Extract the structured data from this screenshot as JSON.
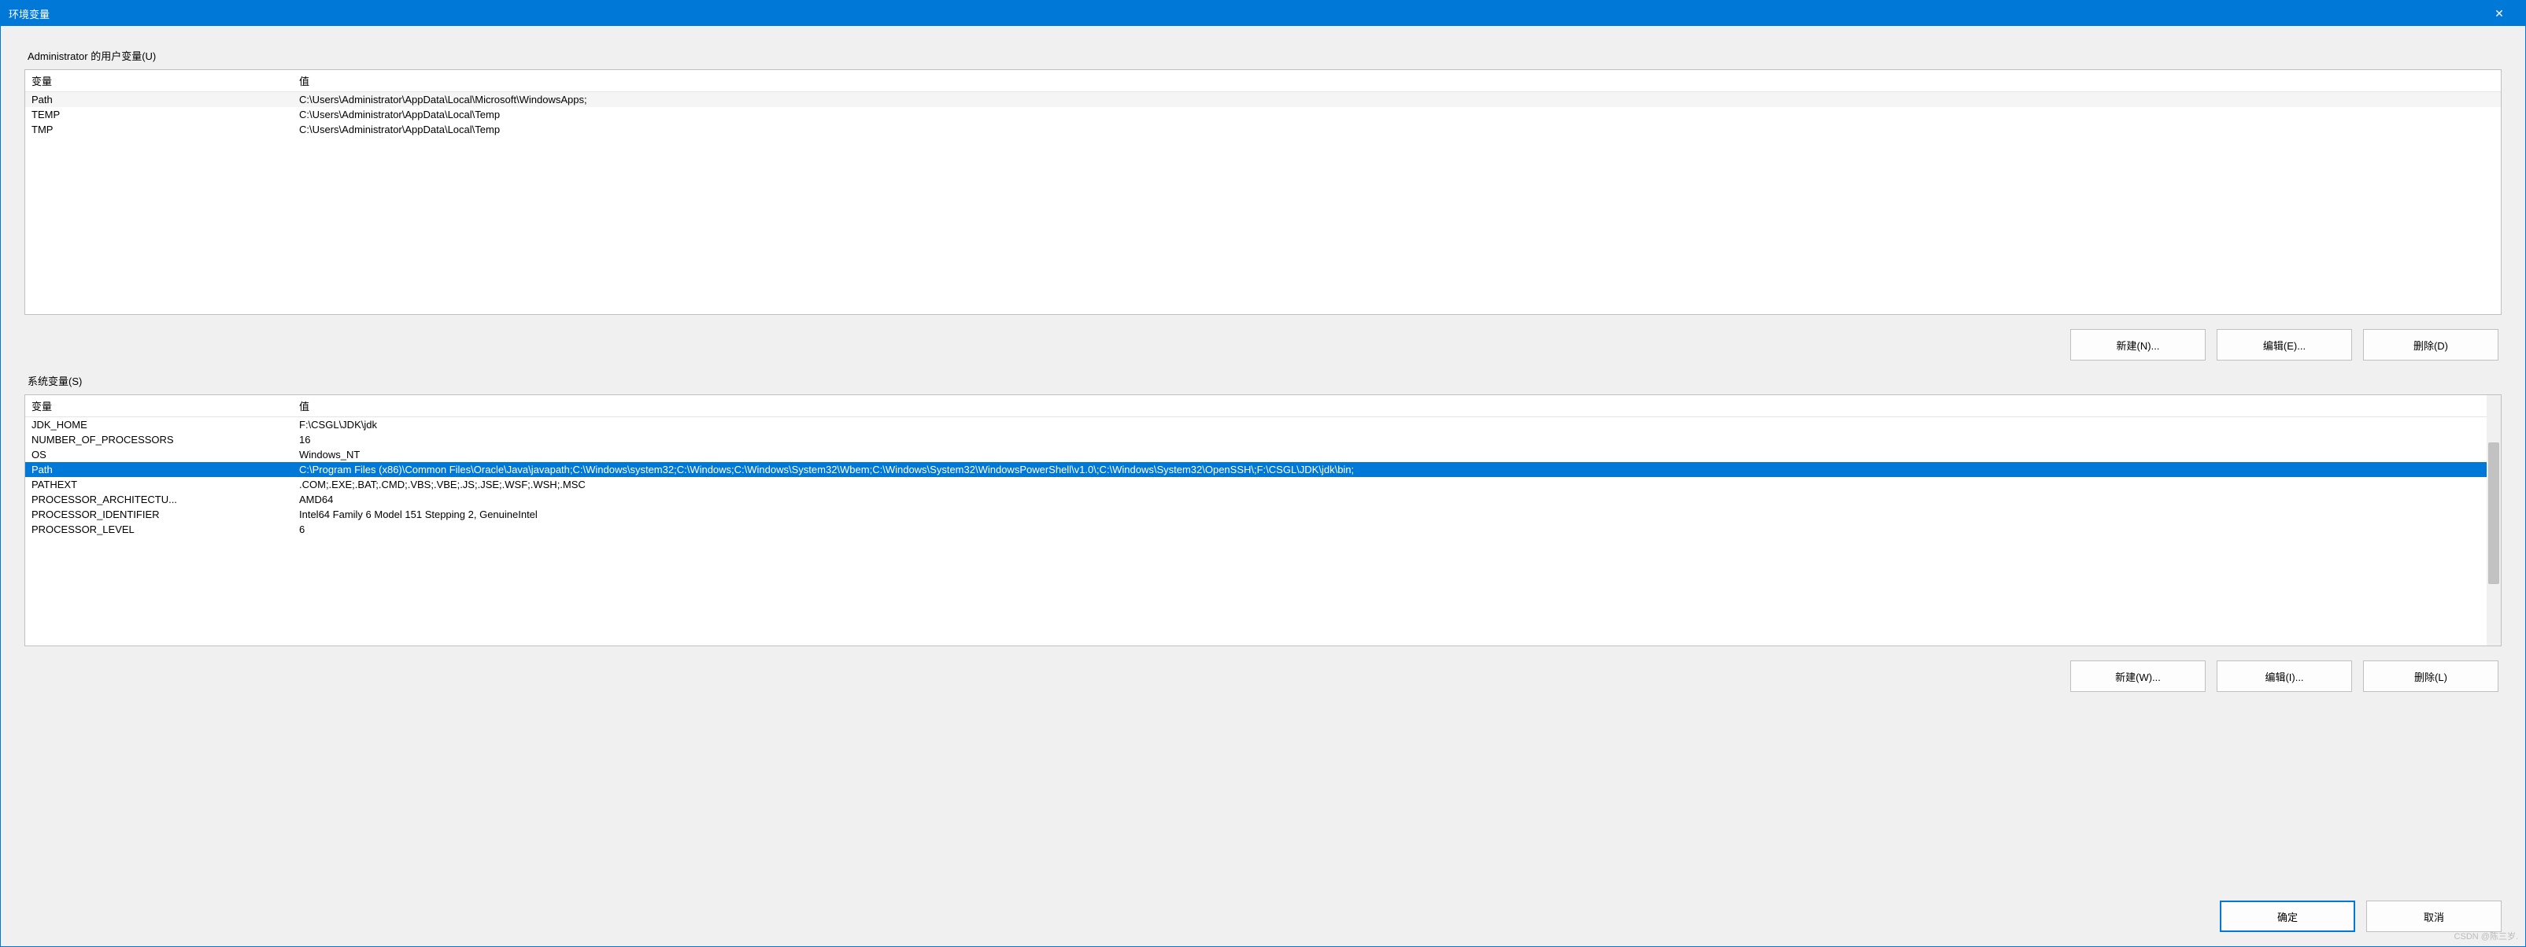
{
  "window": {
    "title": "环境变量",
    "close_icon": "✕"
  },
  "user_section": {
    "label": "Administrator 的用户变量(U)",
    "headers": {
      "name": "变量",
      "value": "值"
    },
    "rows": [
      {
        "name": "Path",
        "value": "C:\\Users\\Administrator\\AppData\\Local\\Microsoft\\WindowsApps;"
      },
      {
        "name": "TEMP",
        "value": "C:\\Users\\Administrator\\AppData\\Local\\Temp"
      },
      {
        "name": "TMP",
        "value": "C:\\Users\\Administrator\\AppData\\Local\\Temp"
      }
    ],
    "buttons": {
      "new": "新建(N)...",
      "edit": "编辑(E)...",
      "delete": "删除(D)"
    }
  },
  "system_section": {
    "label": "系统变量(S)",
    "headers": {
      "name": "变量",
      "value": "值"
    },
    "rows": [
      {
        "name": "JDK_HOME",
        "value": "F:\\CSGL\\JDK\\jdk"
      },
      {
        "name": "NUMBER_OF_PROCESSORS",
        "value": "16"
      },
      {
        "name": "OS",
        "value": "Windows_NT"
      },
      {
        "name": "Path",
        "value": "C:\\Program Files (x86)\\Common Files\\Oracle\\Java\\javapath;C:\\Windows\\system32;C:\\Windows;C:\\Windows\\System32\\Wbem;C:\\Windows\\System32\\WindowsPowerShell\\v1.0\\;C:\\Windows\\System32\\OpenSSH\\;F:\\CSGL\\JDK\\jdk\\bin;",
        "selected": true
      },
      {
        "name": "PATHEXT",
        "value": ".COM;.EXE;.BAT;.CMD;.VBS;.VBE;.JS;.JSE;.WSF;.WSH;.MSC"
      },
      {
        "name": "PROCESSOR_ARCHITECTU...",
        "value": "AMD64"
      },
      {
        "name": "PROCESSOR_IDENTIFIER",
        "value": "Intel64 Family 6 Model 151 Stepping 2, GenuineIntel"
      },
      {
        "name": "PROCESSOR_LEVEL",
        "value": "6"
      }
    ],
    "buttons": {
      "new": "新建(W)...",
      "edit": "编辑(I)...",
      "delete": "删除(L)"
    }
  },
  "dialog_buttons": {
    "ok": "确定",
    "cancel": "取消"
  },
  "watermark": "CSDN @陈三岁."
}
